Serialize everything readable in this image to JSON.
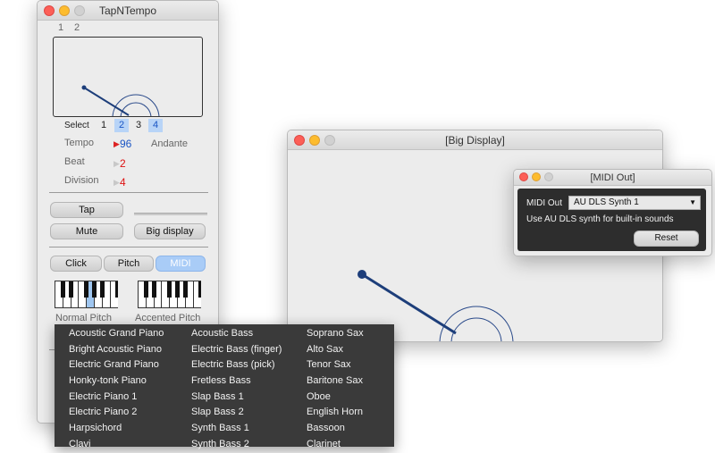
{
  "tapntempo": {
    "title": "TapNTempo",
    "top_tabs": [
      "1",
      "2"
    ],
    "select_label": "Select",
    "select_options": [
      "1",
      "2",
      "3",
      "4"
    ],
    "tempo_label": "Tempo",
    "tempo_value": "96",
    "tempo_name": "Andante",
    "beat_label": "Beat",
    "beat_value": "2",
    "division_label": "Division",
    "division_value": "4",
    "tap_label": "Tap",
    "mute_label": "Mute",
    "big_display_label": "Big display",
    "click_label": "Click",
    "pitch_label": "Pitch",
    "midi_label": "MIDI",
    "normal_pitch_label": "Normal Pitch",
    "accented_pitch_label": "Accented Pitch"
  },
  "instrument_menu": {
    "col1": [
      "Acoustic Grand Piano",
      "Bright Acoustic Piano",
      "Electric Grand Piano",
      "Honky-tonk Piano",
      "Electric Piano 1",
      "Electric Piano 2",
      "Harpsichord",
      "Clavi"
    ],
    "col2": [
      "Acoustic Bass",
      "Electric Bass (finger)",
      "Electric Bass (pick)",
      "Fretless Bass",
      "Slap Bass 1",
      "Slap Bass 2",
      "Synth Bass 1",
      "Synth Bass 2"
    ],
    "col3": [
      "Soprano Sax",
      "Alto Sax",
      "Tenor Sax",
      "Baritone Sax",
      "Oboe",
      "English Horn",
      "Bassoon",
      "Clarinet"
    ]
  },
  "big_display": {
    "title": "[Big Display]"
  },
  "midi_out": {
    "title": "[MIDI Out]",
    "midi_out_label": "MIDI Out",
    "synth_value": "AU DLS Synth 1",
    "hint": "Use AU DLS synth for built-in sounds",
    "reset_label": "Reset"
  },
  "colors": {
    "pendulum": "#1d3e7a",
    "selected_button": "#a9ccf7",
    "red_value": "#dd1111",
    "menu_bg": "#3a3a3a"
  }
}
